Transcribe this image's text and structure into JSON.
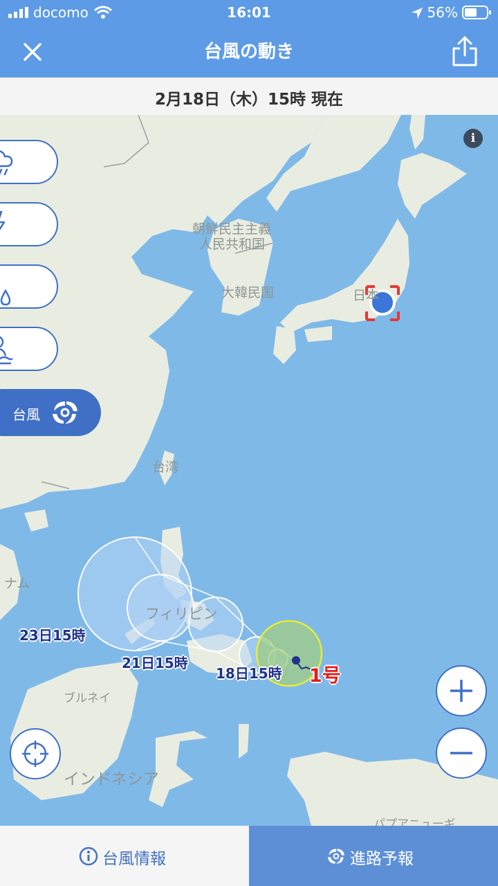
{
  "status_bar": {
    "carrier": "docomo",
    "time": "16:01",
    "battery": "56%"
  },
  "nav": {
    "title": "台風の動き",
    "close_icon": "close-icon",
    "share_icon": "share-icon"
  },
  "date_bar": {
    "text": "2月18日（木）15時 現在"
  },
  "side_buttons": [
    {
      "name": "rain-cloud",
      "icon": "rain-cloud-icon"
    },
    {
      "name": "lightning",
      "icon": "lightning-icon"
    },
    {
      "name": "snow-water",
      "icon": "snowflake-drop-icon"
    },
    {
      "name": "tide",
      "icon": "person-waves-icon"
    }
  ],
  "typhoon_tab": {
    "label": "台風",
    "icon": "typhoon-icon"
  },
  "map_labels": {
    "north_korea_1": "朝鮮民主主義",
    "north_korea_2": "人民共和国",
    "south_korea": "大韓民国",
    "japan": "日本",
    "taiwan": "台湾",
    "vietnam": "ナム",
    "philippines": "フィリピン",
    "brunei": "ブルネイ",
    "indonesia": "インドネシア",
    "papua": "パプアニューギ"
  },
  "track_labels": {
    "day23": "23日15時",
    "day21": "21日15時",
    "day18": "18日15時",
    "typhoon_number": "1号"
  },
  "controls": {
    "zoom_in": "+",
    "zoom_out": "−",
    "locate_icon": "crosshair-icon",
    "info": "i"
  },
  "bottom_tabs": {
    "info_label": "台風情報",
    "route_label": "進路予報"
  },
  "colors": {
    "header": "#5d9be6",
    "accent": "#3f70c5",
    "sea": "#7fb9e8",
    "land": "#e9ede1",
    "typhoon_label": "#e21c1c"
  }
}
